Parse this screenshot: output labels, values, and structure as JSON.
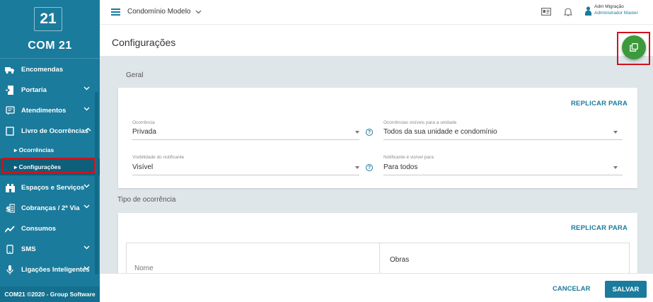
{
  "sidebar": {
    "logo_text": "21",
    "brand_text": "COM 21",
    "items": [
      {
        "label": "Encomendas",
        "icon": "truck-icon"
      },
      {
        "label": "Portaria",
        "icon": "door-icon"
      },
      {
        "label": "Atendimentos",
        "icon": "chat-icon"
      },
      {
        "label": "Livro de Ocorrências",
        "icon": "book-icon"
      },
      {
        "label": "Espaços e Serviços",
        "icon": "building-icon"
      },
      {
        "label": "Cobranças / 2ª Via",
        "icon": "bill-icon"
      },
      {
        "label": "Consumos",
        "icon": "trend-icon"
      },
      {
        "label": "SMS",
        "icon": "phone-icon"
      },
      {
        "label": "Ligações Inteligentes",
        "icon": "mic-icon"
      }
    ],
    "subitems": [
      {
        "label": "▸ Ocorrências"
      },
      {
        "label": "▸ Configurações"
      }
    ],
    "footer": "COM21 ©2020 - Group Software"
  },
  "topbar": {
    "condominio": "Condomínio Modelo",
    "user_name": "Adm Migração",
    "user_role": "Administrador Master"
  },
  "page": {
    "title": "Configurações"
  },
  "geral": {
    "section_label": "Geral",
    "replicar": "REPLICAR PARA",
    "ocorrencia_label": "Ocorrência",
    "ocorrencia_value": "Privada",
    "ocorrencias_visiveis_label": "Ocorrências visíveis para a unidade",
    "ocorrencias_visiveis_value": "Todos da sua unidade e condomínio",
    "visibilidade_label": "Visibilidade do notificante",
    "visibilidade_value": "Visível",
    "notificante_label": "Notificante é visível para",
    "notificante_value": "Para todos",
    "help_glyph": "?"
  },
  "tipo": {
    "section_label": "Tipo de ocorrência",
    "replicar": "REPLICAR PARA",
    "col_nome": "Nome",
    "col_obras": "Obras"
  },
  "actions": {
    "cancel": "CANCELAR",
    "save": "SALVAR"
  },
  "colors": {
    "primary": "#1a7b9c",
    "fab": "#3c9a3c",
    "highlight": "#d0121b"
  }
}
